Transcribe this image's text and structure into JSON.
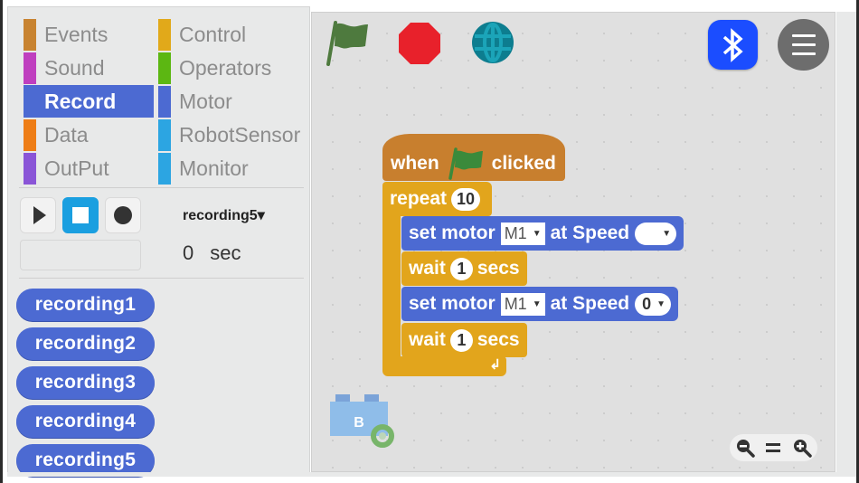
{
  "palette": {
    "categories": [
      {
        "label": "Events",
        "color": "#c88330",
        "selected": false
      },
      {
        "label": "Sound",
        "color": "#bf3fbf",
        "selected": false
      },
      {
        "label": "Record",
        "color": "#4c6ad2",
        "selected": true
      },
      {
        "label": "Data",
        "color": "#ee7d16",
        "selected": false
      },
      {
        "label": "OutPut",
        "color": "#8a55d7",
        "selected": false
      },
      {
        "label": "Control",
        "color": "#e1a91a",
        "selected": false
      },
      {
        "label": "Operators",
        "color": "#5cb712",
        "selected": false
      },
      {
        "label": "Motor",
        "color": "#4c6ad2",
        "selected": false
      },
      {
        "label": "RobotSensor",
        "color": "#2ca5e2",
        "selected": false
      },
      {
        "label": "Monitor",
        "color": "#2ca5e2",
        "selected": false
      }
    ],
    "recorder": {
      "play_icon": "play-icon",
      "stop_icon": "stop-icon",
      "record_icon": "record-icon",
      "active_button": "stop",
      "selected_recording": "recording5▾",
      "time_value": "0",
      "time_unit": "sec"
    },
    "recordings": [
      "recording1",
      "recording2",
      "recording3",
      "recording4",
      "recording5"
    ]
  },
  "toolbar": {
    "green_flag_icon": "green-flag-icon",
    "stop_icon": "stop-sign-icon",
    "globe_icon": "globe-icon",
    "bluetooth_icon": "bluetooth-icon",
    "menu_icon": "hamburger-menu-icon",
    "colors": {
      "flag": "#4e7a3e",
      "stop": "#e8212b",
      "globe": "#0d7d8f",
      "bluetooth": "#1b4dff",
      "menu": "#6d6d6d"
    }
  },
  "script": {
    "hat": {
      "prefix": "when",
      "suffix": "clicked"
    },
    "repeat": {
      "label": "repeat",
      "count": "10"
    },
    "blocks": [
      {
        "type": "motor",
        "label": "set motor",
        "motor": "M1",
        "speed_label": "at Speed",
        "speed": ""
      },
      {
        "type": "wait",
        "label": "wait",
        "value": "1",
        "unit": "secs"
      },
      {
        "type": "motor",
        "label": "set motor",
        "motor": "M1",
        "speed_label": "at Speed",
        "speed": "0"
      },
      {
        "type": "wait",
        "label": "wait",
        "value": "1",
        "unit": "secs"
      }
    ],
    "loop_arrow": "↲"
  },
  "sprite": {
    "letter": "B"
  },
  "zoom": {
    "zoom_out_icon": "zoom-out-icon",
    "reset_label": "=",
    "zoom_in_icon": "zoom-in-icon"
  }
}
